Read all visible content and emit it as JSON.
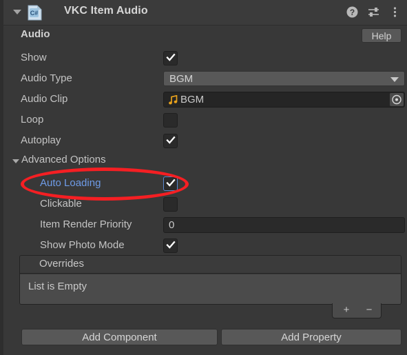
{
  "header": {
    "title": "VKC Item Audio",
    "foldout_arrow_icon": "triangle-down-icon",
    "script_icon": "csharp-script-icon",
    "icons": [
      {
        "name": "help-icon",
        "glyph": "?"
      },
      {
        "name": "preset-settings-icon",
        "glyph": "sliders"
      },
      {
        "name": "more-menu-icon",
        "glyph": "kebab"
      }
    ]
  },
  "section": {
    "title": "Audio",
    "help_label": "Help"
  },
  "properties": [
    {
      "label": "Show",
      "type": "checkbox",
      "value": true,
      "name": "show"
    },
    {
      "label": "Audio Type",
      "type": "dropdown",
      "value": "BGM",
      "name": "audio-type"
    },
    {
      "label": "Audio Clip",
      "type": "object",
      "value": "BGM",
      "icon": "audio-clip-icon",
      "name": "audio-clip"
    },
    {
      "label": "Loop",
      "type": "checkbox",
      "value": false,
      "name": "loop"
    },
    {
      "label": "Autoplay",
      "type": "checkbox",
      "value": true,
      "name": "autoplay"
    }
  ],
  "advanced": {
    "foldout_label": "Advanced Options",
    "expanded": true,
    "properties": [
      {
        "label": "Auto Loading",
        "type": "checkbox",
        "value": true,
        "name": "auto-loading",
        "highlighted": true
      },
      {
        "label": "Clickable",
        "type": "checkbox",
        "value": false,
        "name": "clickable"
      },
      {
        "label": "Item Render Priority",
        "type": "number",
        "value": "0",
        "name": "item-render-priority"
      },
      {
        "label": "Show Photo Mode",
        "type": "checkbox",
        "value": true,
        "name": "show-photo-mode"
      }
    ]
  },
  "overrides_list": {
    "header_label": "Overrides",
    "empty_label": "List is Empty",
    "add_label": "+",
    "remove_label": "−"
  },
  "footer": {
    "add_component_label": "Add Component",
    "add_property_label": "Add Property"
  },
  "colors": {
    "background": "#383838",
    "header_background": "#3b3b3b",
    "text": "#c4c4c4",
    "highlight_text": "#6f9ce8",
    "annotation": "#f51f23",
    "audio_clip_icon": "#e8a21c",
    "button_face": "#585858"
  }
}
